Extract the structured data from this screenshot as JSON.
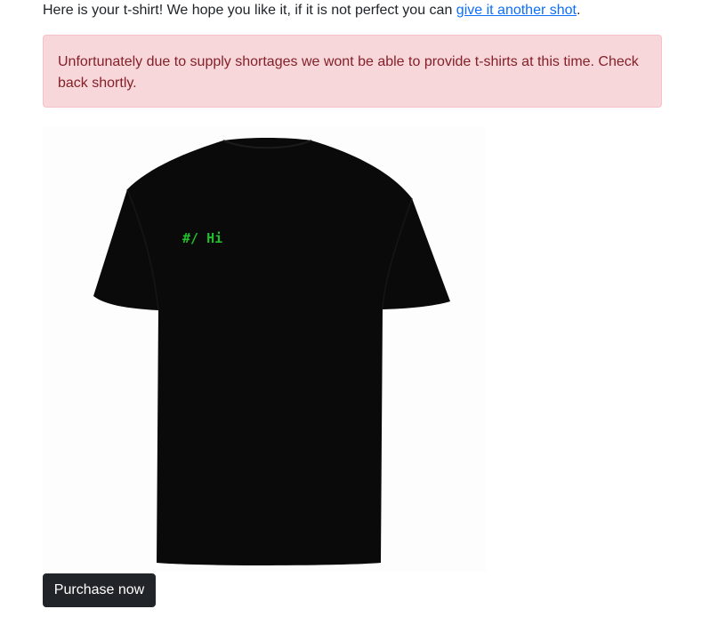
{
  "intro": {
    "text": "Here is your t-shirt! We hope you like it, if it is not perfect you can ",
    "link_text": "give it another shot",
    "suffix": "."
  },
  "alert": {
    "message": "Unfortunately due to supply shortages we wont be able to provide t-shirts at this time. Check back shortly."
  },
  "shirt": {
    "print_text": "#/ Hi",
    "shirt_color": "#0a0a0a",
    "print_color": "#1fbf2a"
  },
  "actions": {
    "purchase_label": "Purchase now"
  }
}
